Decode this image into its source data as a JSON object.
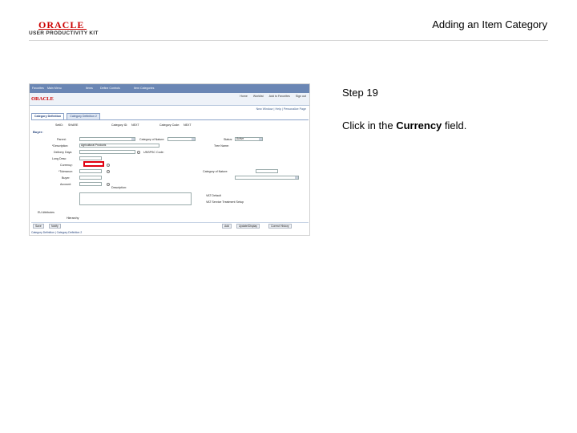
{
  "slide": {
    "title": "Adding an Item Category",
    "logo_brand": "ORACLE",
    "logo_product": "USER PRODUCTIVITY KIT",
    "step": "Step 19",
    "instruction_prefix": "Click in the ",
    "instruction_field": "Currency",
    "instruction_suffix": " field."
  },
  "screenshot": {
    "nav_items": [
      "Favorites",
      "Main Menu",
      "Items",
      "Define Controls",
      "Item Categories"
    ],
    "header_links": [
      "Home",
      "Worklist",
      "Add to Favorites",
      "Sign out"
    ],
    "subbar": [
      "New Window",
      "Help",
      "Personalize Page"
    ],
    "brand": "ORACLE",
    "tabs": [
      "Category Definition",
      "Category Definition 2"
    ],
    "fields": {
      "setid_label": "SetID:",
      "setid_value": "SHARE",
      "category_id_label": "Category ID:",
      "category_id_value": "NEXT",
      "category_code_label": "Category Code:",
      "category_code_value": "NEXT",
      "parent_label": "Parent:",
      "parent_value": "",
      "description_label": "*Description:",
      "description_value": "Agricultural Products",
      "delivery_days_label": "Delivery Days:",
      "delivery_days_value": "",
      "status_label": "Status:",
      "status_value": "Active",
      "tree_name_label": "Tree Name:",
      "tree_name_value": "",
      "currency_label": "Currency:",
      "currency_value": "",
      "tolerance_label": "*Tolerance:",
      "buyer_label": "Buyer:",
      "account_label": "Account:",
      "category_of_label": "Category of Nature:",
      "unspsc_label": "UNSPSC Code:",
      "description2_label": "Description:",
      "longdesc_label": "Long Desc:",
      "vat_label": "VAT Default",
      "vat_service_label": "VAT Service Treatment Setup"
    },
    "section_title": "Buyer:",
    "attributes_label": "EU Attributes",
    "hierarchy_label": "Hierarchy",
    "buttons": [
      "Save",
      "Notify",
      "Add",
      "Update/Display",
      "Correct History"
    ],
    "footer": "Category Definition | Category Definition 2"
  }
}
